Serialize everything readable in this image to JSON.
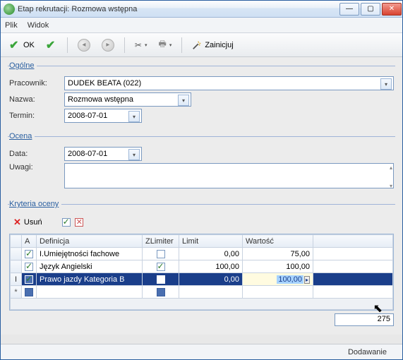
{
  "window": {
    "title": "Etap rekrutacji: Rozmowa wstępna"
  },
  "menu": {
    "file": "Plik",
    "view": "Widok"
  },
  "toolbar": {
    "ok": "OK",
    "init": "Zainicjuj"
  },
  "groups": {
    "general": "Ogólne",
    "rating": "Ocena",
    "criteria": "Kryteria oceny"
  },
  "labels": {
    "employee": "Pracownik:",
    "name": "Nazwa:",
    "term": "Termin:",
    "date": "Data:",
    "remarks": "Uwagi:"
  },
  "values": {
    "employee": "DUDEK BEATA (022)",
    "name": "Rozmowa wstępna",
    "term": "2008-07-01",
    "date": "2008-07-01",
    "remarks": ""
  },
  "criteria_toolbar": {
    "delete": "Usuń"
  },
  "grid": {
    "headers": {
      "active": "A",
      "definition": "Definicja",
      "zlimiter": "ZLimiter",
      "limit": "Limit",
      "value": "Wartość"
    },
    "rows": [
      {
        "active": true,
        "definition": "I.Umiejętności fachowe",
        "zlimiter": false,
        "limit": "0,00",
        "value": "75,00",
        "selected": false
      },
      {
        "active": true,
        "definition": "Język Angielski",
        "zlimiter": true,
        "limit": "100,00",
        "value": "100,00",
        "selected": false
      },
      {
        "active": true,
        "definition": "Prawo jazdy Kategoria B",
        "zlimiter": false,
        "limit": "0,00",
        "value": "100,00",
        "selected": true
      }
    ],
    "sum": "275"
  },
  "status": {
    "mode": "Dodawanie"
  }
}
